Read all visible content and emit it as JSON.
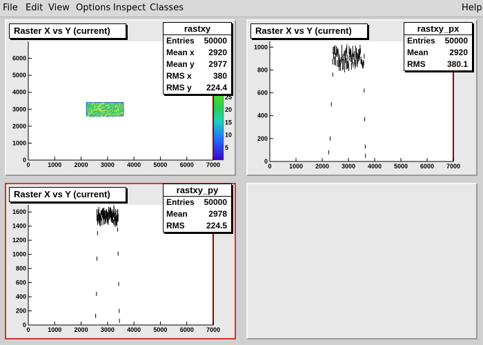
{
  "menu": {
    "file": "File",
    "edit": "Edit",
    "view": "View",
    "options": "Options",
    "inspect": "Inspect",
    "classes": "Classes",
    "help": "Help"
  },
  "pads": {
    "p1": {
      "title": "Raster X vs Y (current)",
      "stats": {
        "name": "rastxy",
        "rows": [
          {
            "label": "Entries",
            "value": "50000"
          },
          {
            "label": "Mean x",
            "value": "2920"
          },
          {
            "label": "Mean y",
            "value": "2977"
          },
          {
            "label": "RMS x",
            "value": "380"
          },
          {
            "label": "RMS y",
            "value": "224.4"
          }
        ]
      },
      "palette_labels": [
        "25",
        "20",
        "15",
        "10",
        "5"
      ]
    },
    "p2": {
      "title": "Raster X vs Y (current)",
      "stats": {
        "name": "rastxy_px",
        "rows": [
          {
            "label": "Entries",
            "value": "50000"
          },
          {
            "label": "Mean",
            "value": "2920"
          },
          {
            "label": "RMS",
            "value": "380.1"
          }
        ]
      }
    },
    "p3": {
      "title": "Raster X vs Y (current)",
      "stats": {
        "name": "rastxy_py",
        "rows": [
          {
            "label": "Entries",
            "value": "50000"
          },
          {
            "label": "Mean",
            "value": "2978"
          },
          {
            "label": "RMS",
            "value": "224.5"
          }
        ]
      }
    }
  },
  "chart_data": [
    {
      "type": "heatmap",
      "title": "Raster X vs Y (current)",
      "x_ticks": [
        "0",
        "1000",
        "2000",
        "3000",
        "4000",
        "5000",
        "6000",
        "7000"
      ],
      "y_ticks": [
        "0",
        "1000",
        "2000",
        "3000",
        "4000",
        "5000",
        "6000"
      ],
      "xlim": [
        0,
        7000
      ],
      "ylim": [
        0,
        7000
      ],
      "filled_region": {
        "x": [
          2200,
          3600
        ],
        "y": [
          2600,
          3400
        ]
      },
      "zlim": [
        0,
        28
      ]
    },
    {
      "type": "scatter",
      "title": "Raster X vs Y (current)",
      "x_ticks": [
        "0",
        "1000",
        "2000",
        "3000",
        "4000",
        "5000",
        "6000",
        "7000"
      ],
      "y_ticks": [
        "0",
        "200",
        "400",
        "600",
        "800",
        "1000"
      ],
      "xlim": [
        0,
        7000
      ],
      "ylim": [
        0,
        1050
      ],
      "band": {
        "x": [
          2400,
          3600
        ],
        "y": [
          820,
          980
        ]
      },
      "edge_points": [
        {
          "x": 2250,
          "y": 80
        },
        {
          "x": 2300,
          "y": 200
        },
        {
          "x": 2350,
          "y": 500
        },
        {
          "x": 2400,
          "y": 760
        },
        {
          "x": 3600,
          "y": 620
        },
        {
          "x": 3620,
          "y": 370
        },
        {
          "x": 3640,
          "y": 130
        },
        {
          "x": 3650,
          "y": 50
        }
      ]
    },
    {
      "type": "scatter",
      "title": "Raster X vs Y (current)",
      "x_ticks": [
        "0",
        "1000",
        "2000",
        "3000",
        "4000",
        "5000",
        "6000",
        "7000"
      ],
      "y_ticks": [
        "0",
        "200",
        "400",
        "600",
        "800",
        "1000",
        "1200",
        "1400",
        "1600"
      ],
      "xlim": [
        0,
        7000
      ],
      "ylim": [
        0,
        1700
      ],
      "band": {
        "x": [
          2600,
          3400
        ],
        "y": [
          1450,
          1620
        ]
      },
      "edge_points": [
        {
          "x": 2550,
          "y": 130
        },
        {
          "x": 2580,
          "y": 440
        },
        {
          "x": 2600,
          "y": 940
        },
        {
          "x": 2620,
          "y": 1300
        },
        {
          "x": 3380,
          "y": 1350
        },
        {
          "x": 3400,
          "y": 1010
        },
        {
          "x": 3420,
          "y": 580
        },
        {
          "x": 3440,
          "y": 200
        },
        {
          "x": 3450,
          "y": 60
        }
      ]
    }
  ]
}
